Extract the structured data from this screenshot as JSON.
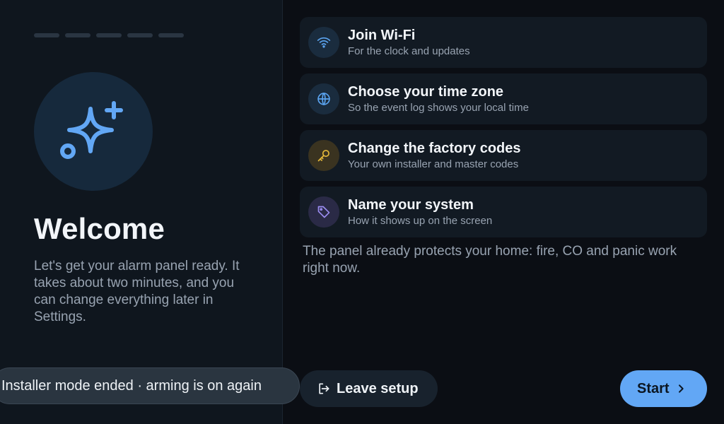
{
  "progress": {
    "total_steps": 5,
    "current_step": 0
  },
  "welcome": {
    "icon": "sparkles-icon",
    "title": "Welcome",
    "intro": "Let's get your alarm panel ready. It takes about two minutes, and you can change everything later in Settings."
  },
  "steps": [
    {
      "icon": "wifi-icon",
      "title": "Join Wi-Fi",
      "subtitle": "For the clock and updates",
      "color": "#5ba4f0",
      "bg": "#1a2c3e"
    },
    {
      "icon": "globe-icon",
      "title": "Choose your time zone",
      "subtitle": "So the event log shows your local time",
      "color": "#5ba4f0",
      "bg": "#1a2c3e"
    },
    {
      "icon": "key-icon",
      "title": "Change the factory codes",
      "subtitle": "Your own installer and master codes",
      "color": "#e5b93a",
      "bg": "#3a3320"
    },
    {
      "icon": "tag-icon",
      "title": "Name your system",
      "subtitle": "How it shows up on the screen",
      "color": "#9a8cf0",
      "bg": "#2a2a46"
    }
  ],
  "note": "The panel already protects your home: fire, CO and panic work right now.",
  "toast": {
    "text": "Installer mode ended · arming is on again"
  },
  "actions": {
    "leave_label": "Leave setup",
    "start_label": "Start"
  },
  "colors": {
    "accent": "#62a7f5",
    "background": "#0b0e14",
    "panel": "#0f161e"
  }
}
